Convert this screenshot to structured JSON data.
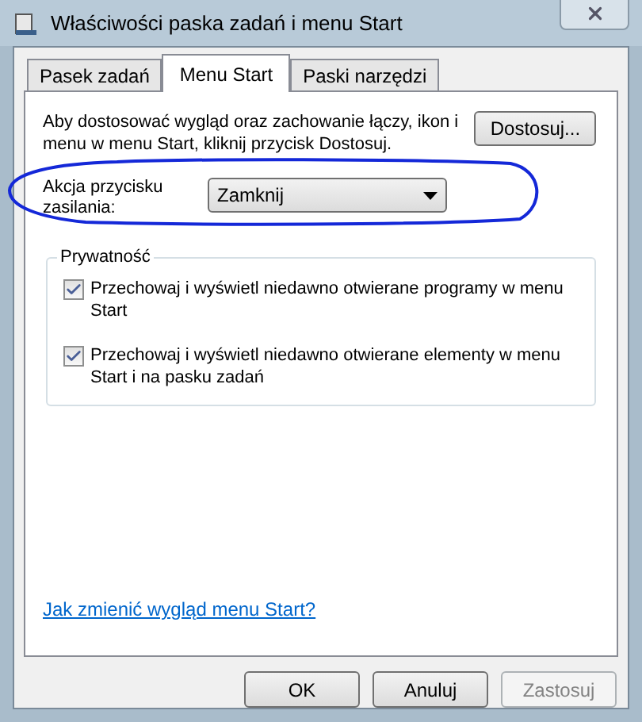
{
  "window": {
    "title": "Właściwości paska zadań i menu Start"
  },
  "tabs": [
    {
      "label": "Pasek zadań",
      "selected": false
    },
    {
      "label": "Menu Start",
      "selected": true
    },
    {
      "label": "Paski narzędzi",
      "selected": false
    }
  ],
  "description": "Aby dostosować wygląd oraz zachowanie łączy, ikon i menu w menu Start, kliknij przycisk Dostosuj.",
  "customize_button": "Dostosuj...",
  "power_action": {
    "label": "Akcja przycisku zasilania:",
    "value": "Zamknij"
  },
  "privacy": {
    "title": "Prywatność",
    "options": [
      {
        "label": "Przechowaj i wyświetl niedawno otwierane programy w menu Start",
        "checked": true
      },
      {
        "label": "Przechowaj i wyświetl niedawno otwierane elementy w menu Start i na pasku zadań",
        "checked": true
      }
    ]
  },
  "help_link": "Jak zmienić wygląd menu Start?",
  "buttons": [
    {
      "label": "OK",
      "disabled": false
    },
    {
      "label": "Anuluj",
      "disabled": false
    },
    {
      "label": "Zastosuj",
      "disabled": true
    }
  ]
}
